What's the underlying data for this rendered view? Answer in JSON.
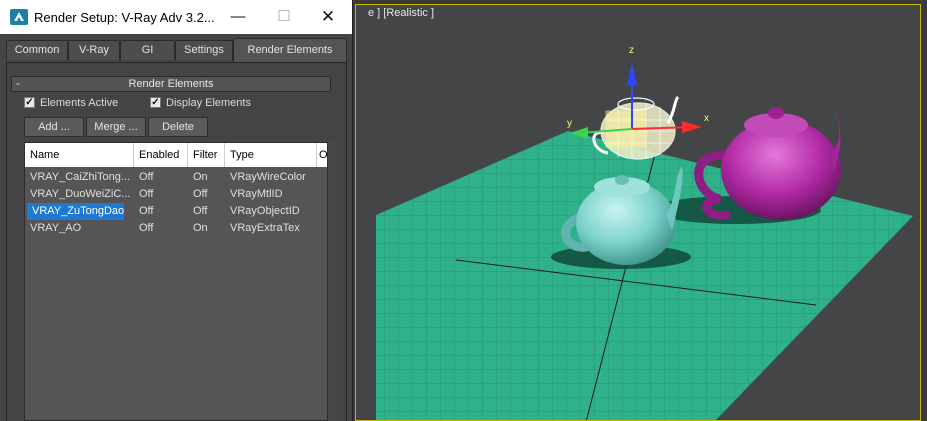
{
  "dialog": {
    "title": "Render Setup: V-Ray Adv 3.2...",
    "minimize": "—",
    "maximize": "☐",
    "close": "✕",
    "tabs": [
      {
        "label": "Common"
      },
      {
        "label": "V-Ray"
      },
      {
        "label": "GI"
      },
      {
        "label": "Settings"
      },
      {
        "label": "Render Elements",
        "active": true
      }
    ],
    "rollout": {
      "toggle": "-",
      "title": "Render Elements"
    },
    "checkboxes": {
      "elements_active": {
        "label": "Elements Active",
        "checked": true,
        "mark": "✓"
      },
      "display_elements": {
        "label": "Display Elements",
        "checked": true,
        "mark": "✓"
      }
    },
    "buttons": {
      "add": "Add ...",
      "merge": "Merge ...",
      "delete": "Delete"
    },
    "list": {
      "columns": [
        "Name",
        "Enabled",
        "Filter",
        "Type",
        "O"
      ],
      "rows": [
        {
          "name": "VRAY_CaiZhiTong...",
          "enabled": "Off",
          "filter": "On",
          "type": "VRayWireColor"
        },
        {
          "name": "VRAY_DuoWeiZiC...",
          "enabled": "Off",
          "filter": "Off",
          "type": "VRayMtlID"
        },
        {
          "name": "VRAY_ZuTongDao",
          "enabled": "Off",
          "filter": "Off",
          "type": "VRayObjectID",
          "selected": true
        },
        {
          "name": "VRAY_AO",
          "enabled": "Off",
          "filter": "On",
          "type": "VRayExtraTex"
        }
      ]
    }
  },
  "viewport": {
    "label": "e ] [Realistic ]",
    "axis_z": "z",
    "axis_x": "x",
    "axis_y": "y",
    "colors": {
      "ground": "#2fb18a",
      "teapot_magenta": "#b52aa8",
      "teapot_cyan": "#7fd6d0",
      "active_border": "#c8b400"
    }
  }
}
